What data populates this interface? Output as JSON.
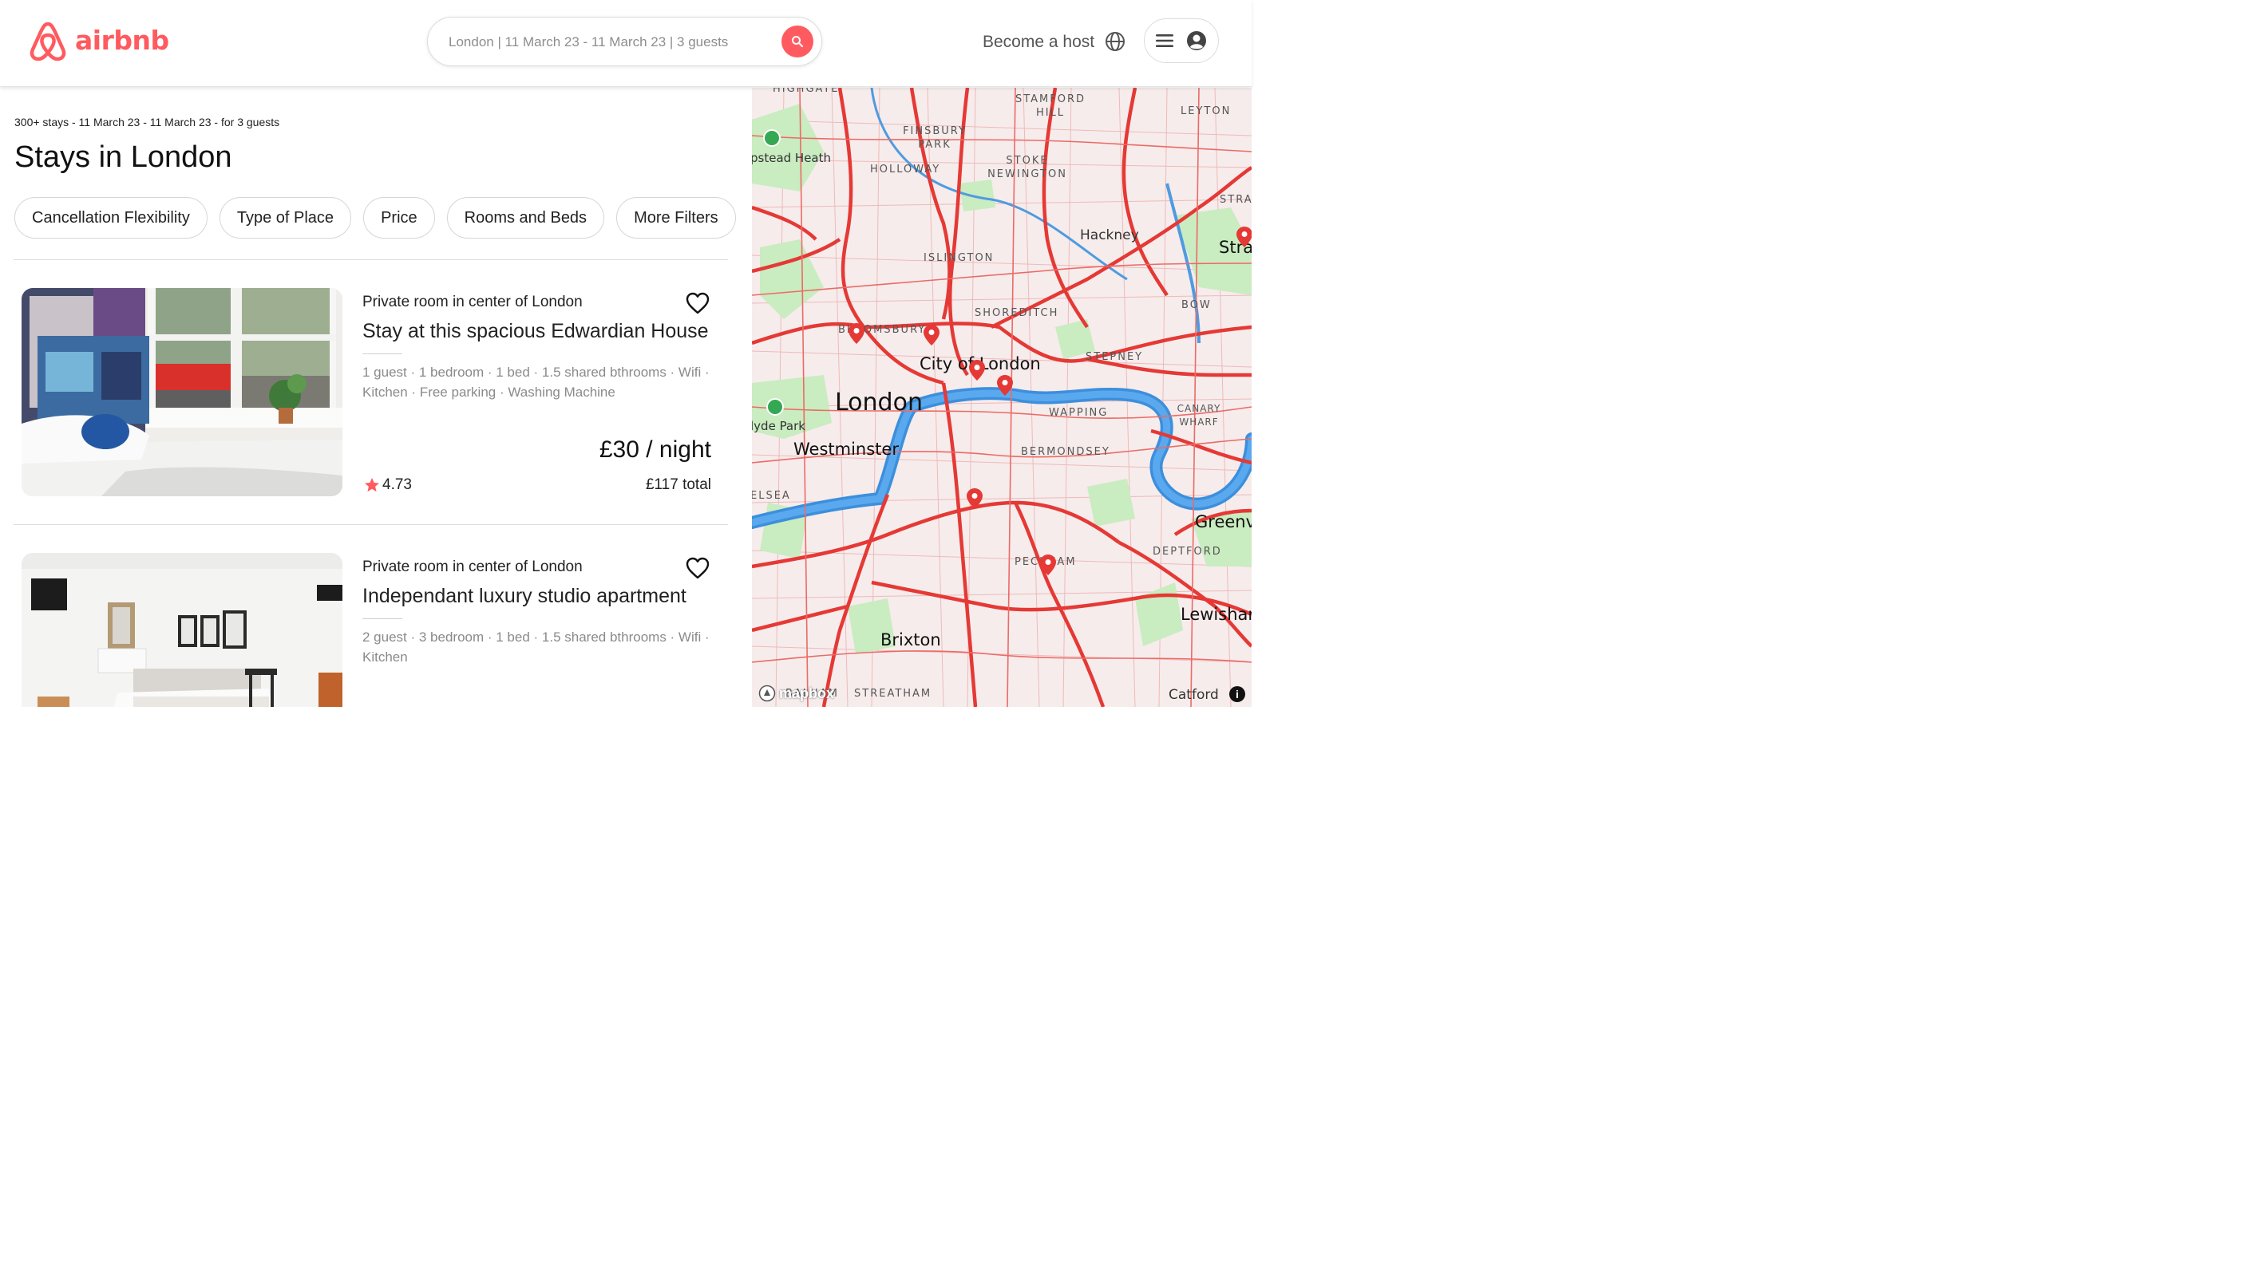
{
  "brand": {
    "name": "airbnb",
    "color": "#ff5a5f"
  },
  "header": {
    "search_summary": "London | 11 March 23 - 11 March 23 | 3 guests",
    "become_host": "Become a host",
    "icons": [
      "search-icon",
      "globe-icon",
      "menu-icon",
      "user-icon"
    ]
  },
  "results": {
    "meta": "300+ stays - 11 March 23 - 11 March 23 - for 3 guests",
    "title": "Stays in London"
  },
  "filters": [
    "Cancellation Flexibility",
    "Type of Place",
    "Price",
    "Rooms and Beds",
    "More Filters"
  ],
  "listings": [
    {
      "type": "Private room in center of London",
      "title": "Stay at this spacious Edwardian House",
      "amenities": "1 guest · 1 bedroom · 1 bed · 1.5 shared bthrooms · Wifi · Kitchen · Free parking · Washing Machine",
      "price": "£30 / night",
      "rating": "4.73",
      "total": "£117 total"
    },
    {
      "type": "Private room in center of London",
      "title": "Independant luxury studio apartment",
      "amenities": "2 guest · 3 bedroom · 1 bed · 1.5 shared bthrooms · Wifi · Kitchen"
    }
  ],
  "map": {
    "labels": {
      "highgate": "HIGHGATE",
      "stamford_hill": "STAMFORD HILL",
      "leyton": "LEYTON",
      "finsbury_park": "FINSBURY PARK",
      "hampstead_heath": "pstead Heath",
      "holloway": "HOLLOWAY",
      "stoke_newington": "STOKE NEWINGTON",
      "stra_top": "STRA",
      "hackney": "Hackney",
      "stra": "Stra",
      "islington": "ISLINGTON",
      "bow": "BOW",
      "shoreditch": "SHOREDITCH",
      "bloomsbury": "BLOOMSBURY",
      "stepney": "STEPNEY",
      "city_of_london": "City of London",
      "london": "London",
      "canary_wharf": "CANARY WHARF",
      "hyde_park": "lyde Park",
      "wapping": "WAPPING",
      "westminster": "Westminster",
      "bermondsey": "BERMONDSEY",
      "chelsea": "ELSEA",
      "greenwich": "Greenv",
      "deptford": "DEPTFORD",
      "peckham": "PECKHAM",
      "lewisham": "Lewishan",
      "brixton": "Brixton",
      "balham": "BALHAM",
      "streatham": "STREATHAM",
      "catford": "Catford"
    },
    "attribution": "mapbox",
    "info": "i",
    "colors": {
      "roads": "#e53935",
      "land": "#f7eeee",
      "river": "#3c8fdc",
      "park": "#c9ecc0"
    }
  }
}
